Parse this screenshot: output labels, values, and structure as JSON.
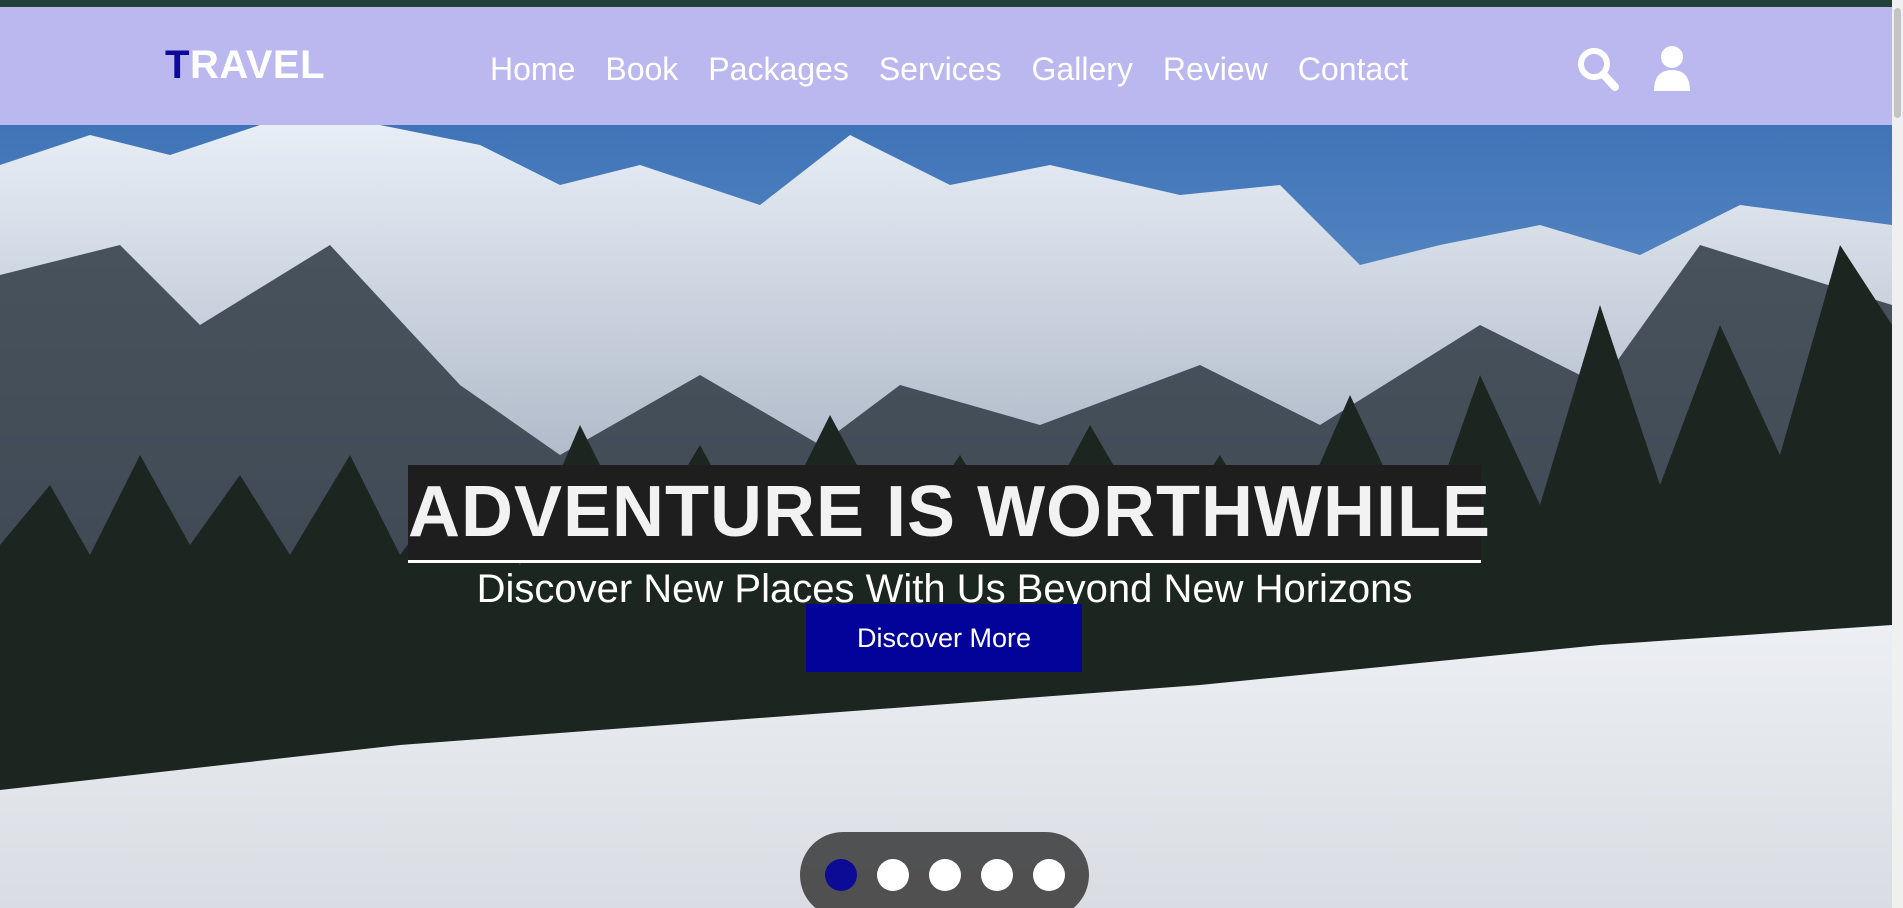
{
  "header": {
    "logo_first": "T",
    "logo_rest": "RAVEL",
    "nav": [
      "Home",
      "Book",
      "Packages",
      "Services",
      "Gallery",
      "Review",
      "Contact"
    ],
    "icons": [
      "search-icon",
      "user-icon"
    ]
  },
  "hero": {
    "title": "ADVENTURE IS WORTHWHILE",
    "subtitle": "Discover New Places With Us Beyond New Horizons",
    "cta": "Discover More",
    "slide_count": 5,
    "active_slide": 1
  },
  "colors": {
    "navbar": "#bbb8f0",
    "logo_accent": "#0a0a9c",
    "cta": "#03039a",
    "active_dot": "#0b0b96"
  }
}
